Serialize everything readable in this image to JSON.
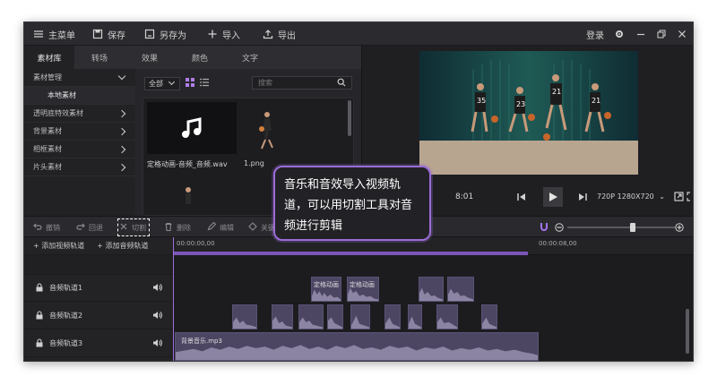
{
  "titlebar": {
    "menu": "主菜单",
    "save": "保存",
    "save_as": "另存为",
    "import": "导入",
    "export": "导出",
    "login": "登录"
  },
  "library_tabs": [
    "素材库",
    "转场",
    "效果",
    "颜色",
    "文字"
  ],
  "categories": [
    {
      "label": "素材管理",
      "expanded": true
    },
    {
      "label": "本地素材",
      "sub": true
    },
    {
      "label": "透明底特效素材"
    },
    {
      "label": "背景素材"
    },
    {
      "label": "相框素材"
    },
    {
      "label": "片头素材"
    }
  ],
  "media": {
    "filter_value": "全部",
    "search_placeholder": "搜索",
    "items": [
      {
        "name": "定格动画-音频_音频.wav",
        "type": "audio"
      },
      {
        "name": "1.png",
        "type": "image"
      }
    ]
  },
  "player": {
    "time": "8:01",
    "resolution": "720P 1280X720"
  },
  "edit_tools": {
    "undo": "撤销",
    "redo": "回退",
    "cut": "切割",
    "delete": "删除",
    "edit": "编辑",
    "keyframe": "关键帧动画"
  },
  "tracks": {
    "add_video": "添加视频轨道",
    "add_audio": "添加音频轨道",
    "ruler_start": "00:00:00,00",
    "ruler_mid": "00:00:08,00",
    "rows": [
      {
        "name": "音频轨道1"
      },
      {
        "name": "音频轨道2"
      },
      {
        "name": "音频轨道3"
      }
    ],
    "clip_label_1": "定格动画",
    "clip_label_3": "背景音乐.mp3"
  },
  "callout": {
    "text": "音乐和音效导入视频轨道，可以用切割工具对音频进行剪辑"
  },
  "colors": {
    "accent": "#9b6cd8",
    "clip": "#4d4663"
  }
}
